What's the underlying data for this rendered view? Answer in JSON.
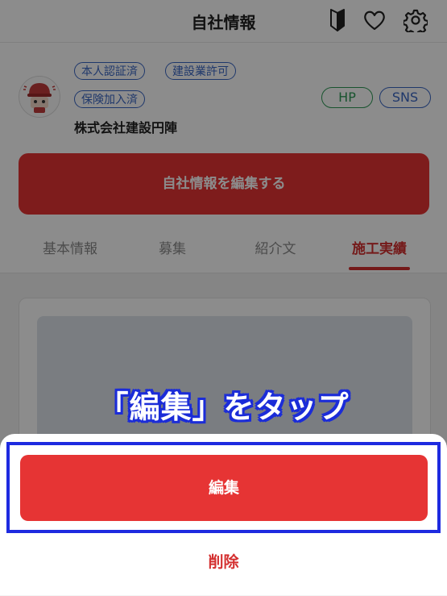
{
  "header": {
    "title": "自社情報",
    "icons": [
      "beginner-mark-icon",
      "heart-icon",
      "gear-icon"
    ]
  },
  "profile": {
    "badges": [
      "本人認証済",
      "建設業許可",
      "保険加入済"
    ],
    "links": {
      "hp": "HP",
      "sns": "SNS"
    },
    "company_name": "株式会社建設円陣",
    "edit_button": "自社情報を編集する"
  },
  "tabs": [
    {
      "label": "基本情報",
      "active": false
    },
    {
      "label": "募集",
      "active": false
    },
    {
      "label": "紹介文",
      "active": false
    },
    {
      "label": "施工実績",
      "active": true
    }
  ],
  "instruction": "「編集」をタップ",
  "sheet": {
    "edit_label": "編集",
    "delete_label": "削除"
  },
  "colors": {
    "accent_red": "#e63434",
    "badge_blue": "#3a66c4",
    "hp_green": "#2e9a57",
    "highlight_blue": "#1e2be0"
  }
}
